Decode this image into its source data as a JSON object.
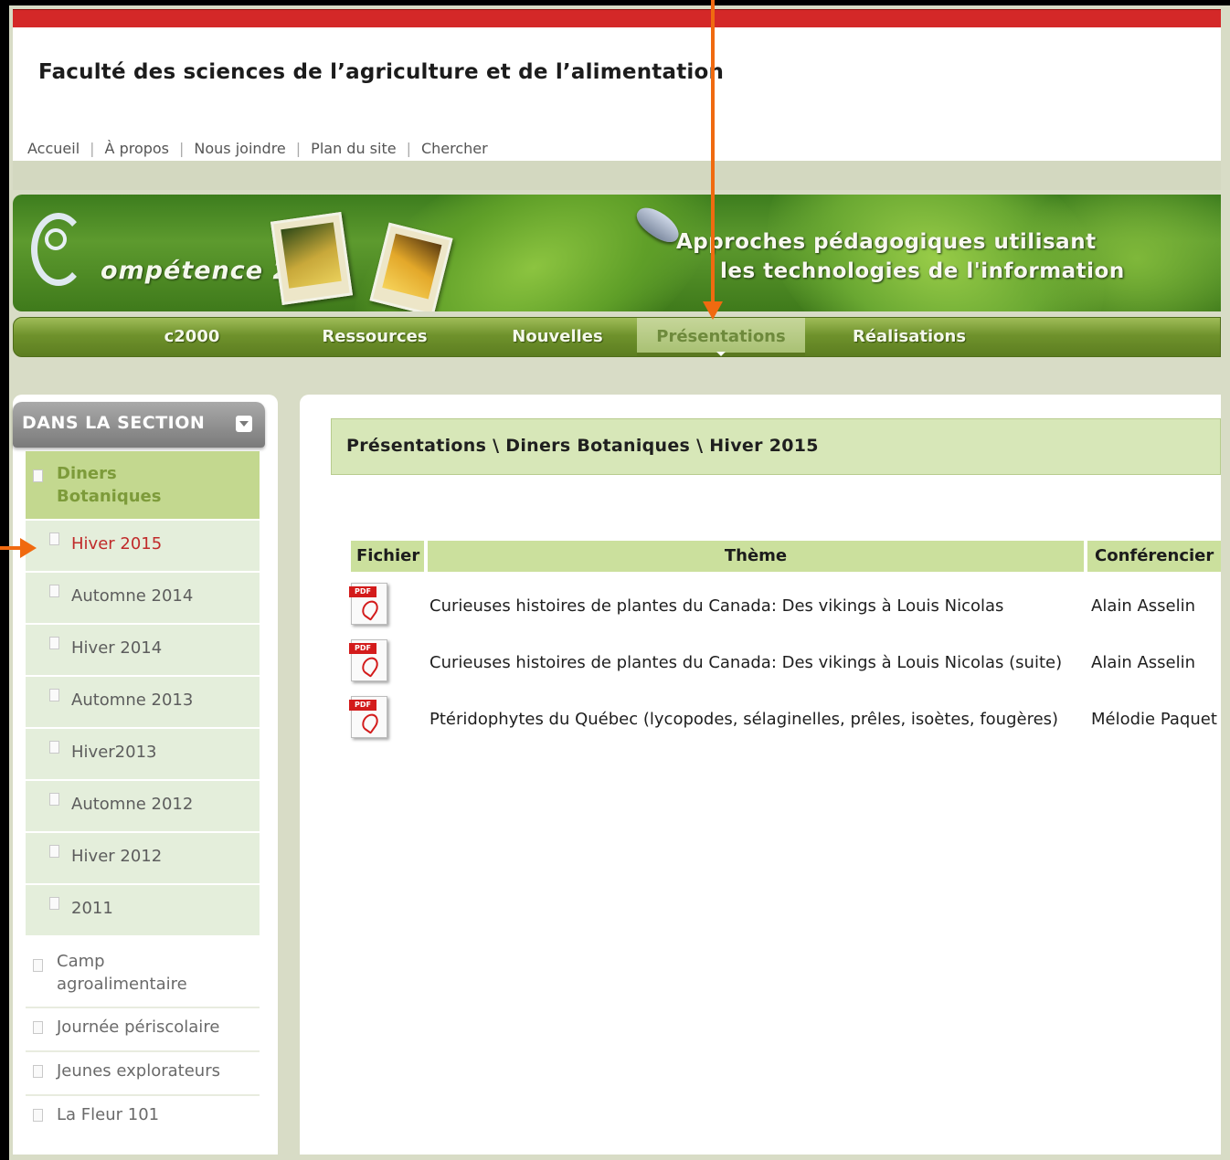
{
  "header": {
    "faculty_title": "Faculté des sciences de l’agriculture et de l’alimentation",
    "links": [
      "Accueil",
      "À propos",
      "Nous joindre",
      "Plan du site",
      "Chercher"
    ]
  },
  "banner": {
    "logo_text": "ompétence 2000",
    "tagline_line1": "Approches pédagogiques utilisant",
    "tagline_line2": "les technologies de l'information"
  },
  "nav": {
    "items": [
      "c2000",
      "Ressources",
      "Nouvelles",
      "Présentations",
      "Réalisations"
    ],
    "active": "Présentations"
  },
  "sidebar": {
    "heading": "DANS LA SECTION",
    "parent": "Diners Botaniques",
    "sub_items": [
      "Hiver 2015",
      "Automne 2014",
      "Hiver 2014",
      "Automne 2013",
      "Hiver2013",
      "Automne 2012",
      "Hiver 2012",
      "2011"
    ],
    "current": "Hiver 2015",
    "other_items": [
      "Camp agroalimentaire",
      "Journée périscolaire",
      "Jeunes explorateurs",
      "La Fleur 101"
    ]
  },
  "breadcrumb": "Présentations \\ Diners Botaniques \\ Hiver 2015",
  "table": {
    "headers": [
      "Fichier",
      "Thème",
      "Conférencier"
    ],
    "rows": [
      {
        "file": "PDF",
        "theme": "Curieuses histoires de plantes du Canada: Des vikings à Louis Nicolas",
        "speaker": "Alain Asselin"
      },
      {
        "file": "PDF",
        "theme": "Curieuses histoires de plantes du Canada: Des vikings à Louis Nicolas (suite)",
        "speaker": "Alain Asselin"
      },
      {
        "file": "PDF",
        "theme": "Ptéridophytes du Québec (lycopodes, sélaginelles, prêles, isoètes, fougères)",
        "speaker": "Mélodie Paquet"
      }
    ]
  },
  "colors": {
    "accent_red": "#d42828",
    "nav_green": "#6f922c",
    "annotation_orange": "#f06a10",
    "current_item_red": "#c02a2a"
  }
}
